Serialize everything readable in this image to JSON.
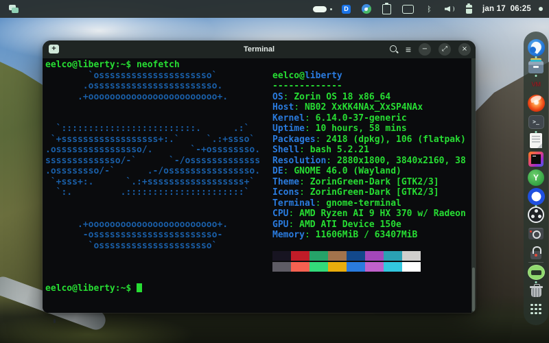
{
  "topbar": {
    "clock": "jan 17  06:25",
    "tray": [
      {
        "name": "dnd-pill"
      },
      {
        "name": "keyboard-layout",
        "glyph": "D"
      },
      {
        "name": "sync"
      },
      {
        "name": "clipboard"
      },
      {
        "name": "screen-share"
      },
      {
        "name": "bluetooth",
        "glyph": "ᛒ"
      },
      {
        "name": "volume"
      },
      {
        "name": "battery"
      }
    ]
  },
  "window": {
    "title": "Terminal",
    "new_tab_glyph": "+",
    "menu_glyph": "≡",
    "minimize_glyph": "−",
    "restore_glyph": "⤢",
    "close_glyph": "×"
  },
  "terminal": {
    "prompt": "eelco@liberty:~$",
    "prompt_with_cmd": "eelco@liberty:~$ neofetch",
    "user": "eelco",
    "at": "@",
    "host": "liberty",
    "underline": "-------------",
    "ascii_art": "        `osssssssssssssssssssso`\n       .osssssssssssssssssssssso.\n      .+oooooooooooooooooooooooo+.\n\n\n  `:::::::::::::::::::::::::.      .:`\n `+ssssssssssssssssss+:.`     `.:+ssso`\n.ossssssssssssssso/.       `-+ossssssso.\nssssssssssssso/-`      `-/osssssssssssss\n.ossssssso/-`      .-/ossssssssssssssso.\n `+sss+:.      `.:+ssssssssssssssssss+`\n  `:.         .::::::::::::::::::::::`\n\n\n      .+oooooooooooooooooooooooo+.\n       -osssssssssssssssssssssso-\n        `osssssssssssssssssssso`",
    "info_rows": [
      {
        "label": "OS",
        "value": "Zorin OS 18 x86_64"
      },
      {
        "label": "Host",
        "value": "NB02 XxKK4NAx_XxSP4NAx"
      },
      {
        "label": "Kernel",
        "value": "6.14.0-37-generic"
      },
      {
        "label": "Uptime",
        "value": "10 hours, 58 mins"
      },
      {
        "label": "Packages",
        "value": "2418 (dpkg), 106 (flatpak)"
      },
      {
        "label": "Shell",
        "value": "bash 5.2.21"
      },
      {
        "label": "Resolution",
        "value": "2880x1800, 3840x2160, 38"
      },
      {
        "label": "DE",
        "value": "GNOME 46.0 (Wayland)"
      },
      {
        "label": "Theme",
        "value": "ZorinGreen-Dark [GTK2/3]"
      },
      {
        "label": "Icons",
        "value": "ZorinGreen-Dark [GTK2/3]"
      },
      {
        "label": "Terminal",
        "value": "gnome-terminal"
      },
      {
        "label": "CPU",
        "value": "AMD Ryzen AI 9 HX 370 w/ Radeon"
      },
      {
        "label": "GPU",
        "value": "AMD ATI Device 150e"
      },
      {
        "label": "Memory",
        "value": "11606MiB / 63407MiB"
      }
    ],
    "palette_row1": [
      "#171421",
      "#C01C28",
      "#26A269",
      "#A2734C",
      "#12488B",
      "#A347BA",
      "#2AA1B3",
      "#D0CFCC"
    ],
    "palette_row2": [
      "#5E5C64",
      "#F66151",
      "#33DA7A",
      "#E9AD0C",
      "#2A7BDE",
      "#C061CB",
      "#33C7DE",
      "#FFFFFF"
    ],
    "colors": {
      "green": "#27dd33",
      "label_blue": "#2a7bde",
      "ascii_blue": "#1a5fa8",
      "background": "#0c0d0f"
    }
  },
  "dock": {
    "items": [
      {
        "name": "zorin-browser",
        "running": true
      },
      {
        "name": "files",
        "running": true
      },
      {
        "name": "vmware",
        "glyph": "VM"
      },
      {
        "name": "app-red-swirl"
      },
      {
        "name": "terminal",
        "glyph": ">_",
        "running": true
      },
      {
        "name": "text-editor"
      },
      {
        "name": "intellij-idea"
      },
      {
        "name": "app-green",
        "glyph": "Y"
      },
      {
        "name": "signal",
        "running": true
      },
      {
        "name": "obs-studio"
      },
      {
        "name": "camera"
      },
      {
        "name": "password-lock"
      },
      {
        "divider": true
      },
      {
        "name": "keyboard-input",
        "running": true
      },
      {
        "name": "trash"
      },
      {
        "name": "app-grid"
      }
    ]
  }
}
